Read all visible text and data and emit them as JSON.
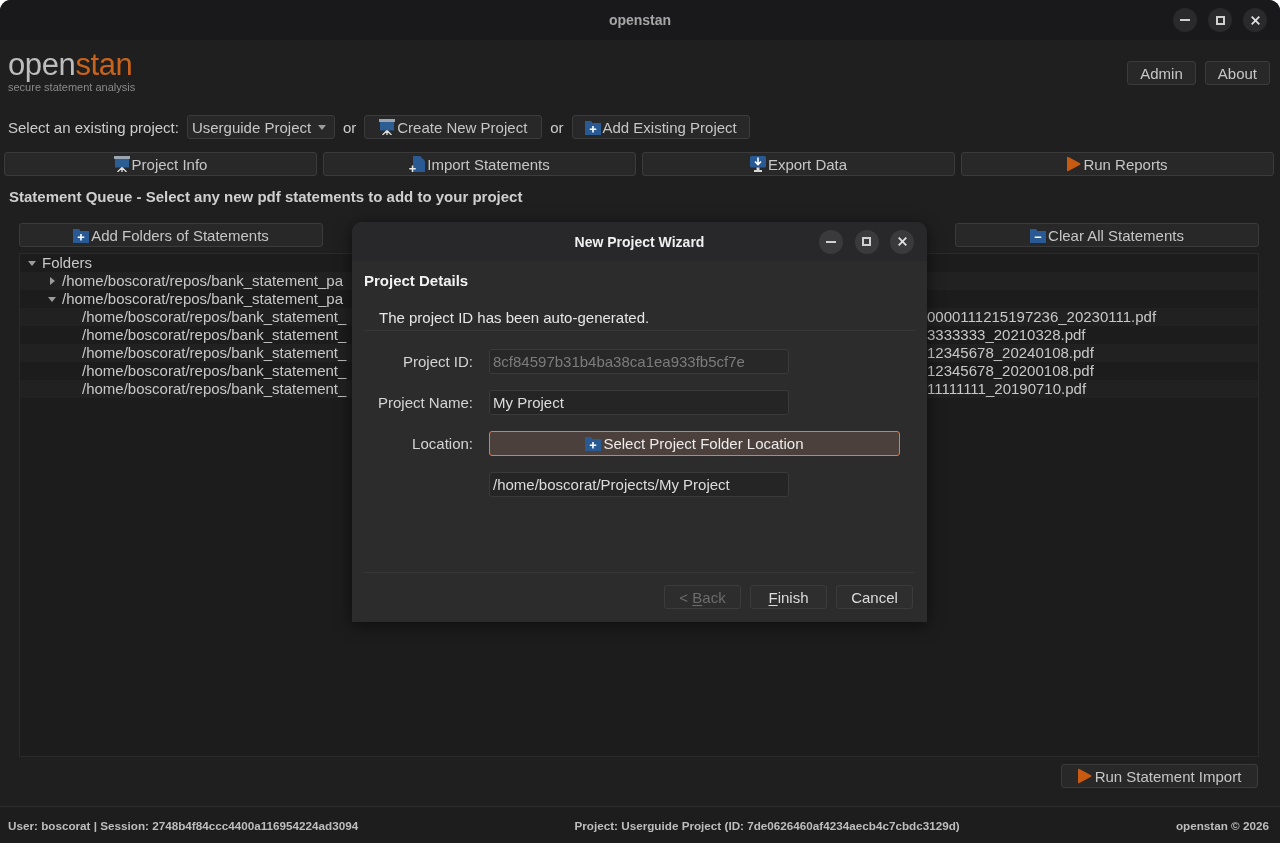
{
  "window": {
    "title": "openstan"
  },
  "header": {
    "logo": {
      "lead": "open",
      "accent": "stan"
    },
    "tagline": "secure statement analysis",
    "buttons": [
      {
        "label": "Admin"
      },
      {
        "label": "About"
      }
    ]
  },
  "project_bar": [
    {
      "kind": "label",
      "text": "Select an existing project:"
    },
    {
      "kind": "select",
      "value": "Userguide Project"
    },
    {
      "kind": "text",
      "text": "or"
    },
    {
      "kind": "button",
      "label": "Create New Project"
    },
    {
      "kind": "text",
      "text": "or"
    },
    {
      "kind": "button",
      "label": "Add Existing Project"
    }
  ],
  "nav_buttons": [
    {
      "label": "Project Info"
    },
    {
      "label": "Import Statements"
    },
    {
      "label": "Export Data"
    },
    {
      "label": "Run Reports"
    }
  ],
  "statement_queue": {
    "heading": "Statement Queue - Select any new pdf statements to add to your project",
    "buttons": [
      {
        "label": "Add Folders of Statements"
      },
      {
        "label": "Clear All Statements"
      }
    ],
    "tree": [
      {
        "label": "Folders",
        "expanded": true,
        "children": [
          {
            "label": "/home/boscorat/repos/bank_statement_pa",
            "expanded": false
          },
          {
            "label": "/home/boscorat/repos/bank_statement_pa",
            "expanded": true,
            "children": [
              {
                "visible_parts": [
                  "/home/boscorat/repos/bank_statement_",
                  "0000111215197236_20230111.pdf"
                ]
              },
              {
                "visible_parts": [
                  "/home/boscorat/repos/bank_statement_",
                  "3333333_20210328.pdf"
                ]
              },
              {
                "visible_parts": [
                  "/home/boscorat/repos/bank_statement_",
                  "12345678_20240108.pdf"
                ]
              },
              {
                "visible_parts": [
                  "/home/boscorat/repos/bank_statement_",
                  "12345678_20200108.pdf"
                ]
              },
              {
                "visible_parts": [
                  "/home/boscorat/repos/bank_statement_",
                  "11111111_20190710.pdf"
                ]
              }
            ]
          }
        ]
      }
    ],
    "run_button": {
      "label": "Run Statement Import"
    }
  },
  "wizard_dialog": {
    "title": "New Project Wizard",
    "page_title": "Project Details",
    "page_subtitle": "The project ID has been auto-generated.",
    "fields": [
      {
        "kind": "input",
        "label": "Project ID:",
        "value": "8cf84597b31b4ba38ca1ea933fb5cf7e",
        "disabled": true,
        "focused": false
      },
      {
        "kind": "input",
        "label": "Project Name:",
        "value": "My Project",
        "disabled": false,
        "focused": false
      },
      {
        "kind": "button",
        "label": "Location:",
        "button_label": "Select Project Folder Location",
        "disabled": false,
        "focused": true
      },
      {
        "kind": "input",
        "value": "/home/boscorat/Projects/My Project",
        "disabled": false,
        "focused": false
      }
    ],
    "buttons": [
      {
        "label_parts": [
          {
            "text": "< ",
            "underlined": false
          },
          {
            "text": "B",
            "underlined": true
          },
          {
            "text": "ack",
            "underlined": false
          }
        ],
        "disabled": true
      },
      {
        "label_parts": [
          {
            "text": "F",
            "underlined": true
          },
          {
            "text": "inish",
            "underlined": false
          }
        ],
        "disabled": false
      },
      {
        "label_parts": [
          {
            "text": "Cancel",
            "underlined": false
          }
        ],
        "disabled": false
      }
    ]
  },
  "status_bar": {
    "user_session": "User: boscorat | Session: 2748b4f84ccc4400a116954224ad3094",
    "project": "Project: Userguide Project (ID: 7de0626460af4234aecb4c7cbdc3129d)",
    "copyright": "openstan © 2026"
  }
}
